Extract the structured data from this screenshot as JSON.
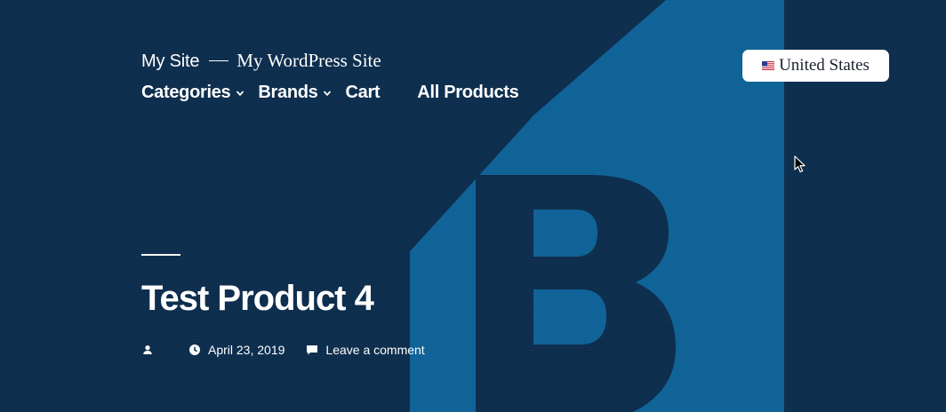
{
  "site": {
    "title": "My Site",
    "description": "My WordPress Site"
  },
  "nav": {
    "items": [
      {
        "label": "Categories",
        "has_submenu": true
      },
      {
        "label": "Brands",
        "has_submenu": true
      },
      {
        "label": "Cart",
        "has_submenu": false
      },
      {
        "label": "All Products",
        "has_submenu": false
      }
    ]
  },
  "country_selector": {
    "flag_icon": "us-flag-icon",
    "label": "United States"
  },
  "entry": {
    "title": "Test Product 4",
    "date": "April 23, 2019",
    "comments_link": "Leave a comment"
  },
  "colors": {
    "background_dark": "#0b2c4c",
    "accent_blue": "#0d6196",
    "text": "#ffffff"
  }
}
